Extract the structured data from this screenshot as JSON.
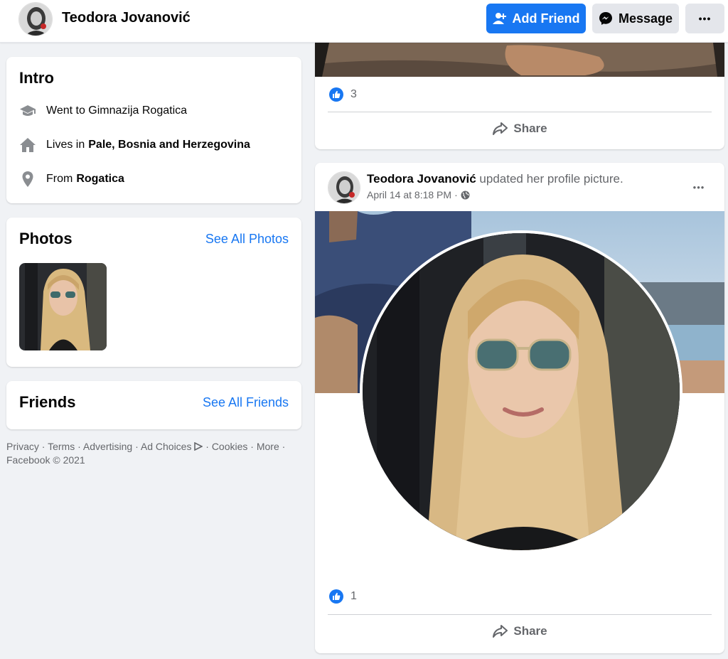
{
  "header": {
    "name": "Teodora Jovanović",
    "add_friend_label": "Add Friend",
    "message_label": "Message",
    "more_label": "•••"
  },
  "intro": {
    "title": "Intro",
    "education": "Went to Gimnazija Rogatica",
    "lives_prefix": "Lives in",
    "lives_place": "Pale, Bosnia and Herzegovina",
    "from_prefix": "From",
    "from_place": "Rogatica"
  },
  "photos": {
    "title": "Photos",
    "see_all": "See All Photos"
  },
  "friends": {
    "title": "Friends",
    "see_all": "See All Friends"
  },
  "footer": {
    "privacy": "Privacy",
    "terms": "Terms",
    "advertising": "Advertising",
    "ad_choices": "Ad Choices",
    "cookies": "Cookies",
    "more": "More",
    "copyright": "Facebook © 2021",
    "separator": "·"
  },
  "post1": {
    "like_count": "3",
    "share_label": "Share"
  },
  "post2": {
    "author": "Teodora Jovanović",
    "action": "updated her profile picture.",
    "timestamp": "April 14 at 8:18 PM",
    "meta_separator": "·",
    "like_count": "1",
    "share_label": "Share",
    "more_label": "•••"
  },
  "colors": {
    "brand_blue": "#1877f2",
    "background": "#f0f2f5",
    "secondary_text": "#65676b",
    "button_gray": "#e4e6eb"
  },
  "icons": {
    "add_friend": "person-plus-icon",
    "message": "messenger-icon",
    "education": "graduation-cap-icon",
    "home": "house-icon",
    "location": "map-pin-icon",
    "like": "thumbs-up-icon",
    "share": "share-arrow-icon",
    "privacy": "globe-icon",
    "ad_choices": "ad-choices-icon"
  }
}
